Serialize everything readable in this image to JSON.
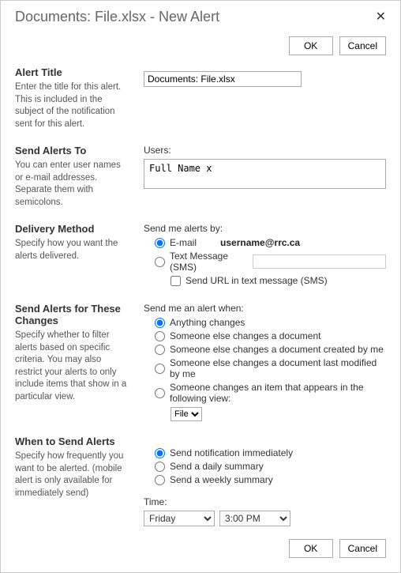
{
  "dialog": {
    "title": "Documents: File.xlsx - New Alert"
  },
  "buttons": {
    "ok": "OK",
    "cancel": "Cancel"
  },
  "alert_title": {
    "heading": "Alert Title",
    "desc": "Enter the title for this alert. This is included in the subject of the notification sent for this alert.",
    "value": "Documents: File.xlsx"
  },
  "send_to": {
    "heading": "Send Alerts To",
    "desc": "You can enter user names or e-mail addresses. Separate them with semicolons.",
    "users_label": "Users:",
    "users_value": "Full Name x"
  },
  "delivery": {
    "heading": "Delivery Method",
    "desc": "Specify how you want the alerts delivered.",
    "sendby_label": "Send me alerts by:",
    "email_label": "E-mail",
    "email_value": "username@rrc.ca",
    "sms_label": "Text Message (SMS)",
    "sendurl_label": "Send URL in text message (SMS)"
  },
  "changes": {
    "heading": "Send Alerts for These Changes",
    "desc": "Specify whether to filter alerts based on specific criteria. You may also restrict your alerts to only include items that show in a particular view.",
    "when_label": "Send me an alert when:",
    "opt_anything": "Anything changes",
    "opt_someone_doc": "Someone else changes a document",
    "opt_someone_created": "Someone else changes a document created by me",
    "opt_someone_modified": "Someone else changes a document last modified by me",
    "opt_view": "Someone changes an item that appears in the following view:",
    "view_value": "File"
  },
  "when": {
    "heading": "When to Send Alerts",
    "desc": "Specify how frequently you want to be alerted. (mobile alert is only available for immediately send)",
    "opt_immediate": "Send notification immediately",
    "opt_daily": "Send a daily summary",
    "opt_weekly": "Send a weekly summary",
    "time_label": "Time:",
    "day_value": "Friday",
    "hour_value": "3:00 PM"
  }
}
